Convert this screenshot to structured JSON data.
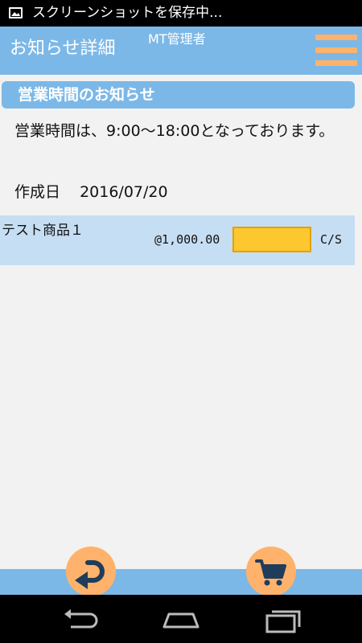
{
  "status_bar": {
    "notification_text": "スクリーンショットを保存中...",
    "icon": "image-icon"
  },
  "header": {
    "title": "お知らせ詳細",
    "user": "MT管理者",
    "menu_icon": "hamburger-menu-icon",
    "menu_color": "#ffb26b",
    "bg_color": "#7cb8e7"
  },
  "notice": {
    "title": "営業時間のお知らせ",
    "body": "営業時間は、9:00～18:00となっております。",
    "created_label": "作成日",
    "created_date": "2016/07/20"
  },
  "product": {
    "name": "テスト商品１",
    "price": "@1,000.00",
    "quantity": "",
    "unit": "C/S",
    "row_color": "#c5def3",
    "input_color": "#fdc72f"
  },
  "footer": {
    "back_icon": "return-arrow-icon",
    "cart_icon": "shopping-cart-icon",
    "button_color": "#ffb26b"
  },
  "nav_bar": {
    "back_icon": "back-icon",
    "home_icon": "home-icon",
    "recents_icon": "recent-apps-icon"
  }
}
